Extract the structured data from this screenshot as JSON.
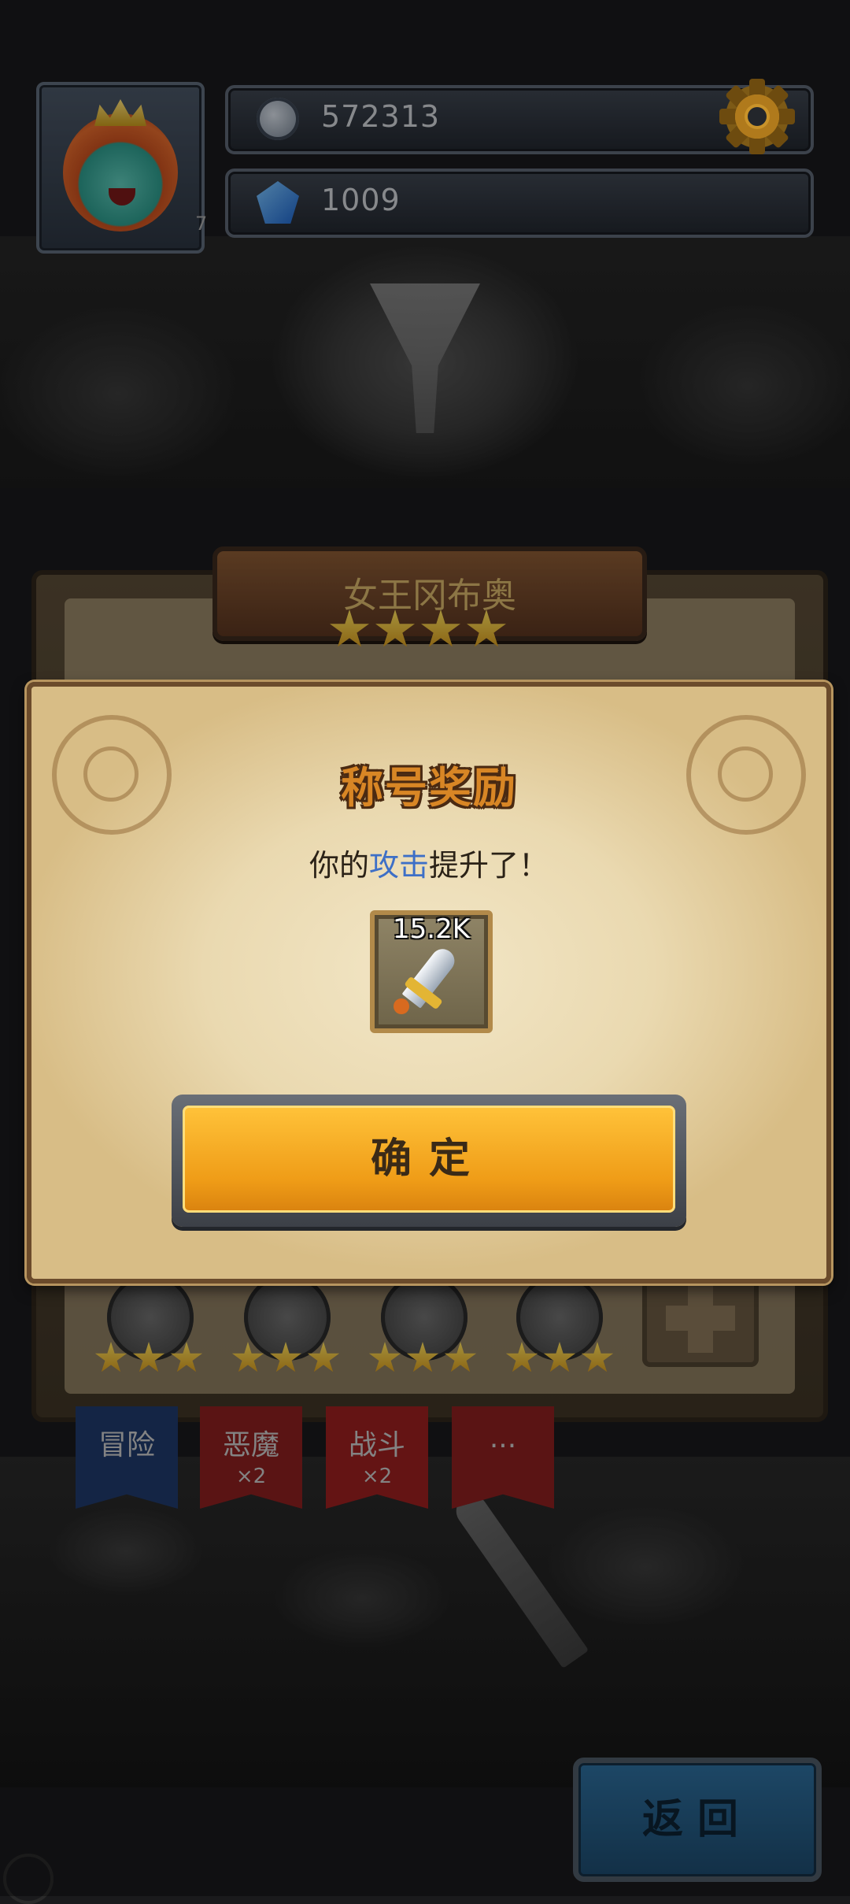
{
  "hud": {
    "coins": "572313",
    "gems": "1009",
    "avatar_level": "7"
  },
  "hero_card": {
    "name": "女王冈布奥",
    "star_count": 4,
    "slot_star_count": 3,
    "tabs": [
      {
        "label": "冒险",
        "sub": "",
        "color": "#1f3a6b"
      },
      {
        "label": "恶魔",
        "sub": "×2",
        "color": "#8a1f1f"
      },
      {
        "label": "战斗",
        "sub": "×2",
        "color": "#9a1f1f"
      },
      {
        "label": "...",
        "sub": "",
        "color": "#8a1f1f"
      }
    ]
  },
  "dialog": {
    "title": "称号奖励",
    "message_prefix": "你的",
    "message_highlight": "攻击",
    "message_suffix": "提升了！",
    "reward_amount": "15.2K",
    "reward_icon": "sword-icon",
    "confirm_label": "确定"
  },
  "footer": {
    "back_label": "返回"
  },
  "colors": {
    "highlight_blue": "#3d6fc7",
    "confirm_gold": "#ef9c17",
    "title_orange": "#d88625"
  }
}
